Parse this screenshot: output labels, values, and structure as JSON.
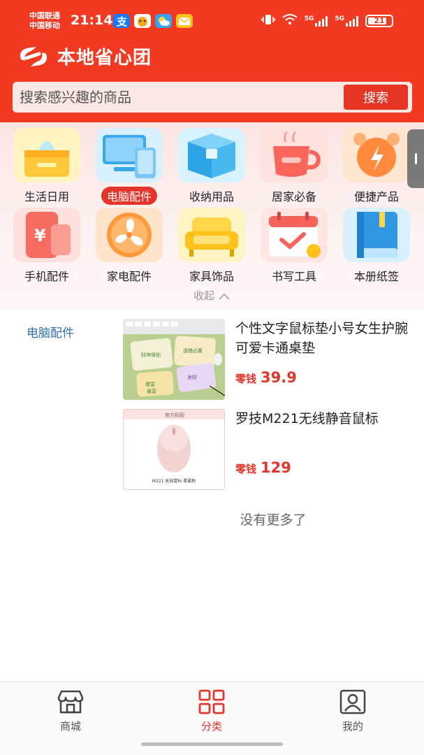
{
  "status_bar": {
    "carrier_1": "中国联通",
    "carrier_2": "中国移动",
    "time": "21:14",
    "net_1": "5G",
    "net_2": "5G",
    "battery": "21"
  },
  "header": {
    "brand": "本地省心团",
    "search_placeholder": "搜索感兴趣的商品",
    "search_button": "搜索",
    "accent_color": "#f23a22"
  },
  "categories": [
    {
      "label": "生活日用",
      "icon": "tissue-box-icon"
    },
    {
      "label": "电脑配件",
      "icon": "computer-icon",
      "active": true
    },
    {
      "label": "收纳用品",
      "icon": "storage-box-icon"
    },
    {
      "label": "居家必备",
      "icon": "mug-icon"
    },
    {
      "label": "便捷产品",
      "icon": "alarm-clock-icon"
    },
    {
      "label": "手机配件",
      "icon": "phone-icon"
    },
    {
      "label": "家电配件",
      "icon": "fan-icon"
    },
    {
      "label": "家具饰品",
      "icon": "sofa-icon"
    },
    {
      "label": "书写工具",
      "icon": "calendar-icon"
    },
    {
      "label": "本册纸签",
      "icon": "notebook-icon"
    }
  ],
  "collapse_label": "收起",
  "selected_category": "电脑配件",
  "products": [
    {
      "title": "个性文字鼠标垫小号女生护腕可爱卡通桌垫",
      "price_label": "零钱",
      "price": "39.9",
      "image_text": [
        "财神保佑",
        "逢赌必赢",
        "爆富",
        "发财",
        "暴富"
      ]
    },
    {
      "title": "罗技M221无线静音鼠标",
      "price_label": "零钱",
      "price": "129",
      "image_text": [
        "官方标配",
        "M221 无线鼠标 柔雾粉"
      ]
    }
  ],
  "no_more": "没有更多了",
  "tabs": [
    {
      "label": "商城",
      "icon": "store-icon",
      "active": false
    },
    {
      "label": "分类",
      "icon": "category-grid-icon",
      "active": true
    },
    {
      "label": "我的",
      "icon": "profile-icon",
      "active": false
    }
  ]
}
